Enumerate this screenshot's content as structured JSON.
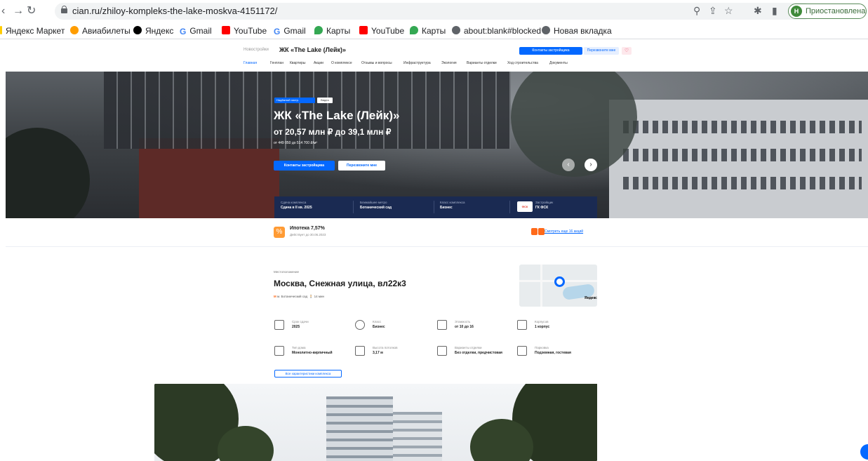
{
  "browser": {
    "url": "cian.ru/zhiloy-kompleks-the-lake-moskva-4151172/",
    "profile_initial": "Н",
    "profile_label": "Приостановлена"
  },
  "bookmarks": [
    {
      "label": "Яндекс Маркет",
      "icon": "yandex-market-icon",
      "color": "#ffcc00"
    },
    {
      "label": "Авиабилеты",
      "icon": "plane-icon",
      "color": "#ff9d00"
    },
    {
      "label": "Яндекс",
      "icon": "yandex-icon",
      "color": "#000000"
    },
    {
      "label": "Gmail",
      "icon": "google-icon",
      "color": "#4285f4"
    },
    {
      "label": "YouTube",
      "icon": "youtube-icon",
      "color": "#ff0000"
    },
    {
      "label": "Gmail",
      "icon": "google-icon",
      "color": "#4285f4"
    },
    {
      "label": "Карты",
      "icon": "maps-pin-icon",
      "color": "#34a853"
    },
    {
      "label": "YouTube",
      "icon": "youtube-icon",
      "color": "#ff0000"
    },
    {
      "label": "Карты",
      "icon": "maps-pin-icon",
      "color": "#34a853"
    },
    {
      "label": "about:blank#blocked",
      "icon": "globe-icon",
      "color": "#5f6368"
    },
    {
      "label": "Новая вкладка",
      "icon": "globe-icon",
      "color": "#5f6368"
    }
  ],
  "header": {
    "breadcrumb": "Новостройки",
    "title": "ЖК «The Lake (Лейк)»",
    "contacts_button": "Контакты застройщика",
    "callback_button": "Перезвоните мне",
    "favorite_icon": "heart-icon"
  },
  "tabs": [
    "Главная",
    "Генплан",
    "Квартиры",
    "Акции",
    "О комплексе",
    "Отзывы и вопросы",
    "Инфраструктура",
    "Экология",
    "Варианты отделки",
    "Ход строительства",
    "Документы"
  ],
  "hero": {
    "badge_reliable": "Надёжный застр.",
    "badge_video": "Видео",
    "title": "ЖК «The Lake (Лейк)»",
    "price": "от 20,57 млн ₽ до 39,1 млн ₽",
    "price_per_sqm": "от 449 050 до 514 700 ₽/м²",
    "contacts_button": "Контакты застройщика",
    "callback_button": "Перезвоните мне",
    "info": [
      {
        "label": "Сдача комплекса",
        "value": "Сдача в II кв. 2025"
      },
      {
        "label": "Ближайшее метро",
        "value": "Ботанический сад"
      },
      {
        "label": "Класс комплекса",
        "value": "Бизнес"
      },
      {
        "label": "Застройщик",
        "value": "ГК ФСК"
      }
    ],
    "developer_logo_text": "ФСК"
  },
  "mortgage": {
    "title": "Ипотека 7,57%",
    "subtitle": "Действует до 30.06.2023",
    "promos_link": "Смотреть еще 16 акций"
  },
  "location": {
    "label": "Местоположение",
    "address": "Москва, Снежная улица, вл22к3",
    "metro": "м. Ботанический сад",
    "walk": "14 мин",
    "map_brand": "Яндекс"
  },
  "characteristics": [
    {
      "label": "Срок сдачи",
      "value": "2025",
      "icon": "calendar-icon"
    },
    {
      "label": "Класс",
      "value": "Бизнес",
      "icon": "star-badge-icon"
    },
    {
      "label": "Этажность",
      "value": "от 10 до 16",
      "icon": "floors-icon"
    },
    {
      "label": "Корпусов",
      "value": "1 корпус",
      "icon": "building-icon"
    },
    {
      "label": "Тип дома",
      "value": "Монолитно-кирпичный",
      "icon": "house-type-icon"
    },
    {
      "label": "Высота потолков",
      "value": "3,17 м",
      "icon": "ceiling-height-icon"
    },
    {
      "label": "Варианты отделки",
      "value": "Без отделки, предчистовая",
      "icon": "paint-roller-icon"
    },
    {
      "label": "Парковка",
      "value": "Подземная, гостевая",
      "icon": "parking-icon"
    }
  ],
  "all_characteristics_button": "Все характеристики комплекса",
  "colors": {
    "accent": "#0468ff",
    "infobar": "#1a2a52",
    "orange": "#ff9b34"
  }
}
